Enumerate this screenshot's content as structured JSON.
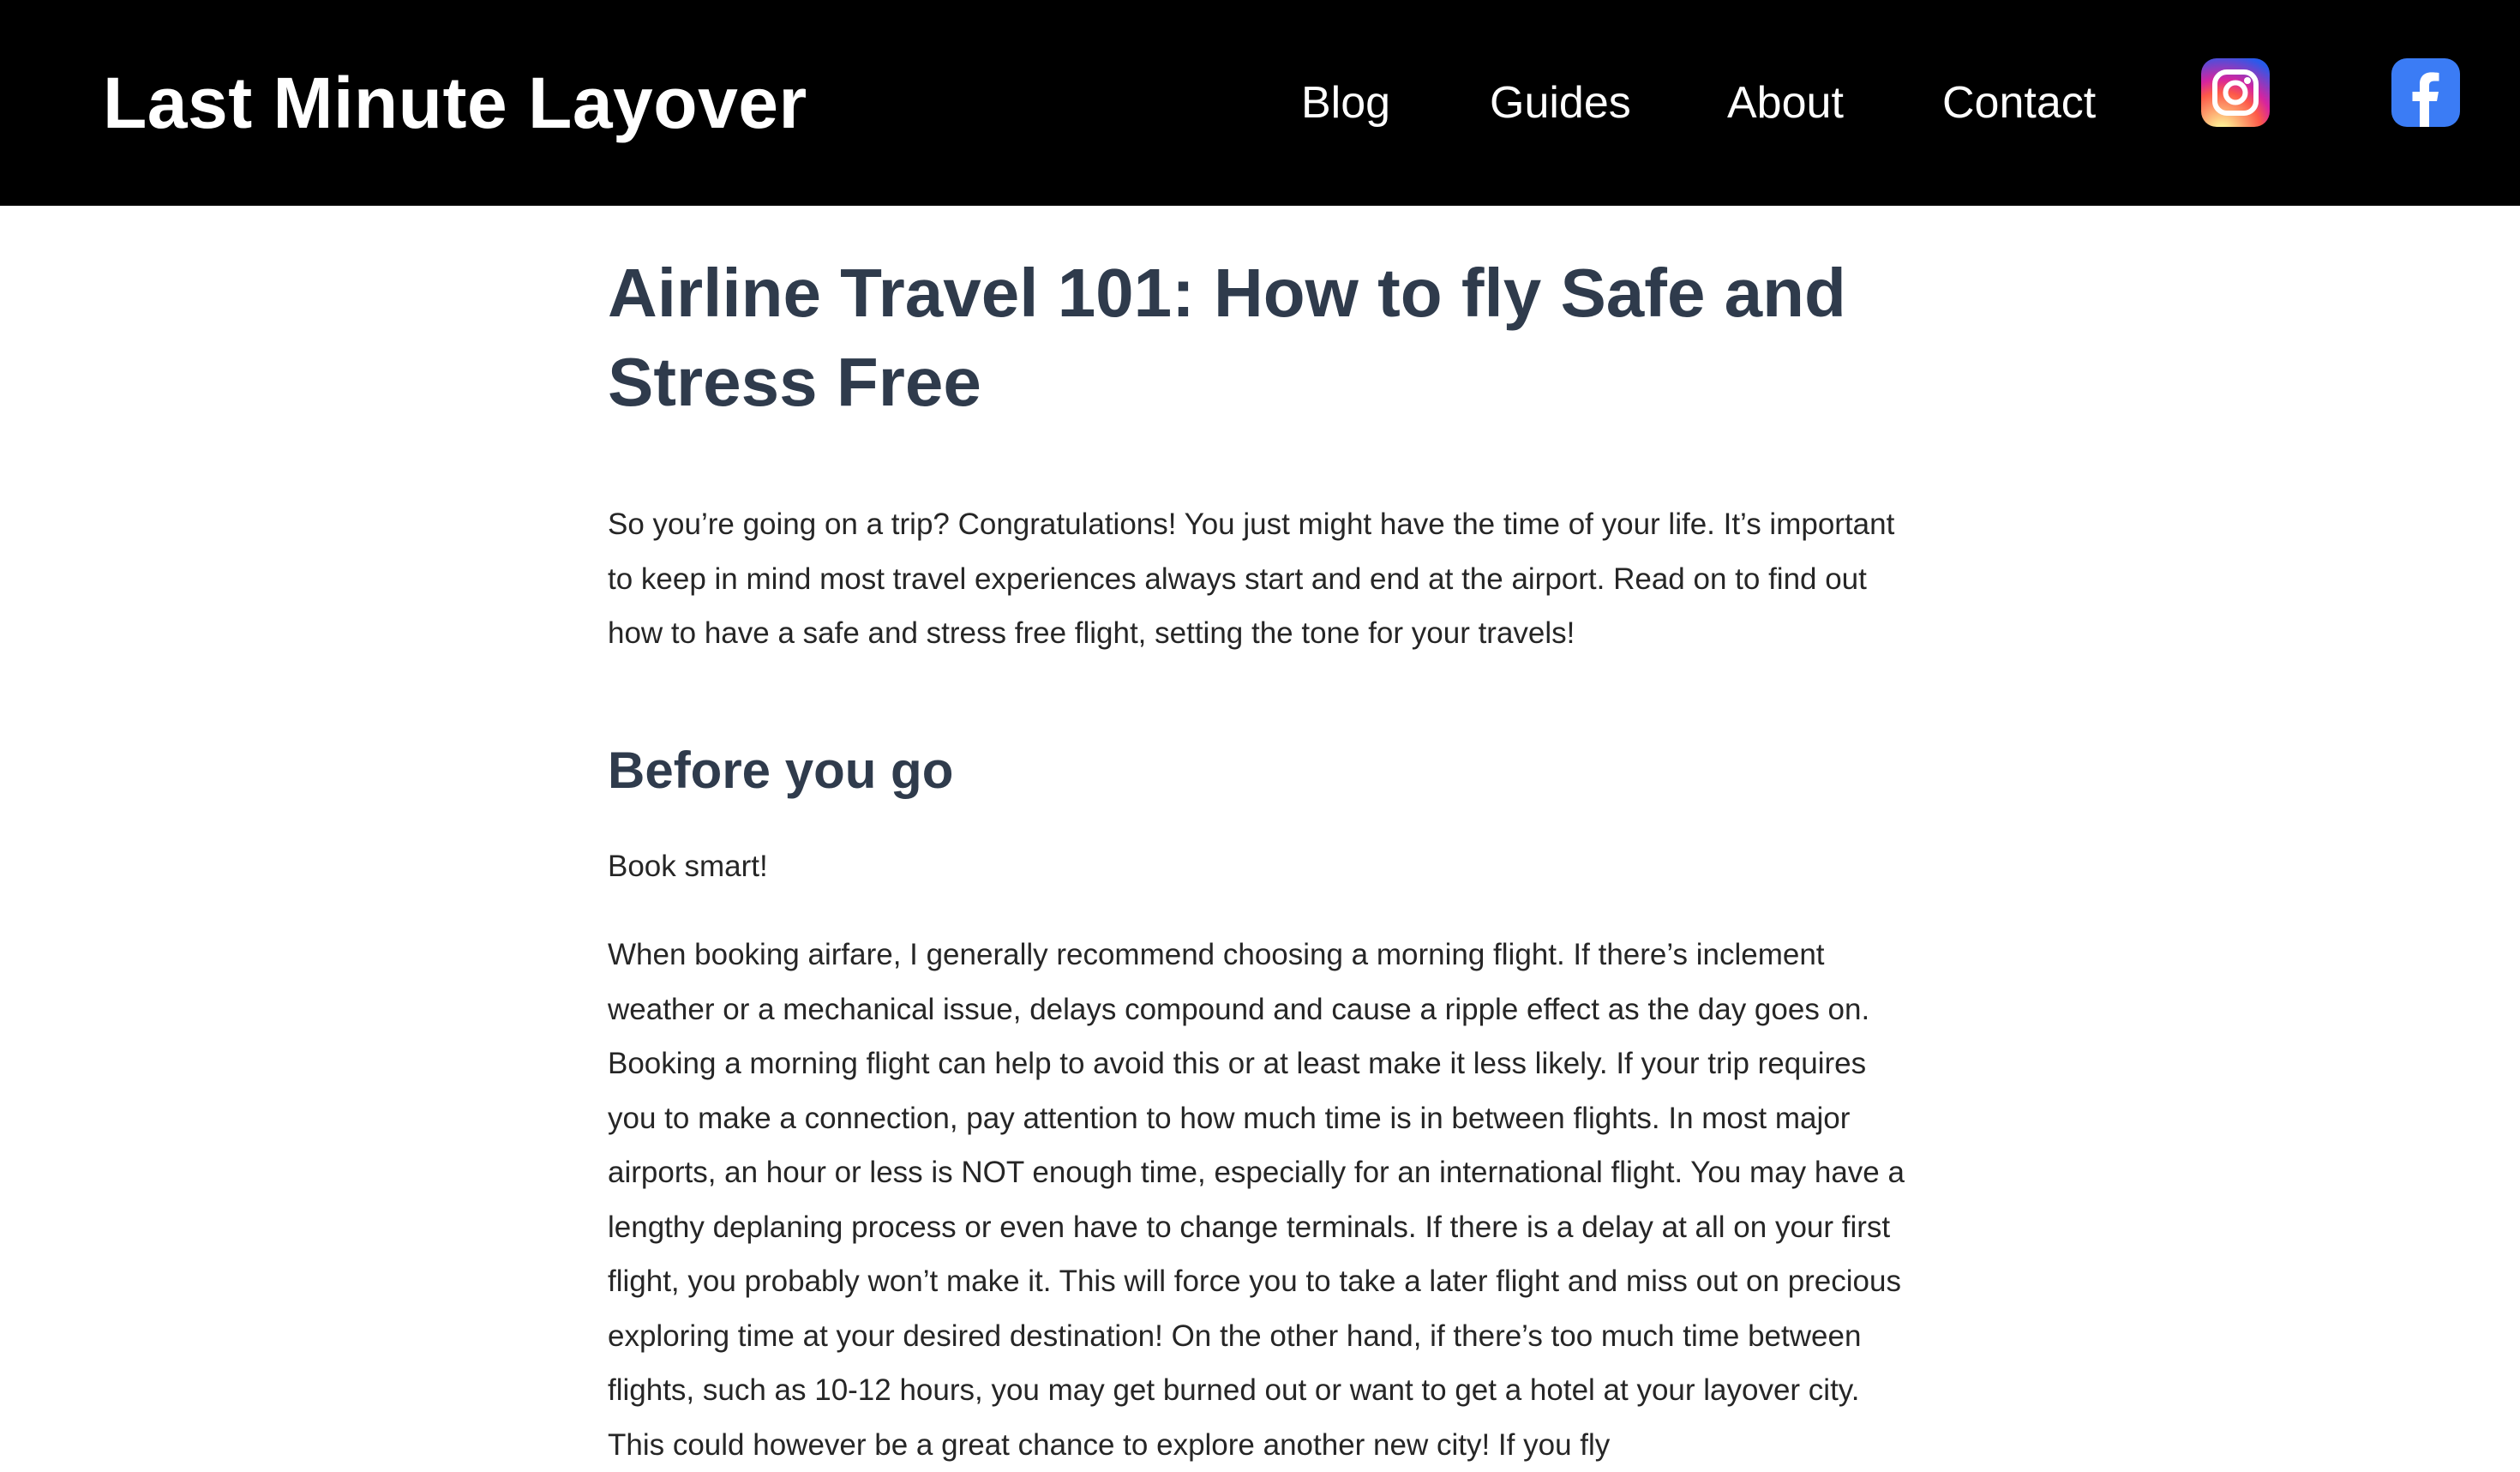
{
  "header": {
    "brand": "Last Minute Layover",
    "nav": [
      "Blog",
      "Guides",
      "About",
      "Contact"
    ],
    "social": [
      {
        "icon": "instagram-icon"
      },
      {
        "icon": "facebook-icon"
      }
    ]
  },
  "article": {
    "title": "Airline Travel 101: How to fly Safe and Stress Free",
    "intro": "So you’re going on a trip? Congratulations! You just might have the time of your life. It’s important to keep in mind most travel experiences always start and end at the airport. Read on to find out how to have a safe and stress free flight, setting the tone for your travels!",
    "section_heading": "Before you go",
    "section_sub": "Book smart!",
    "section_body": "When booking airfare, I generally recommend choosing a morning flight. If there’s inclement weather or a mechanical issue, delays compound and cause a ripple effect as the day goes on. Booking a morning flight can help to avoid this or at least make it less likely. If your trip requires you to make a connection, pay attention to how much time is in between flights. In most major airports, an hour or less is NOT enough time, especially for an international flight. You may have a lengthy deplaning process or even have to change terminals. If there is a delay at all on your first flight, you probably won’t make it. This will force you to take a later flight and miss out on precious exploring time at your desired destination! On the other hand, if there’s too much time between flights, such as 10-12 hours, you may get burned out or want to get a hotel at your layover city. This could however be a great chance to explore another new city! If you fly"
  }
}
